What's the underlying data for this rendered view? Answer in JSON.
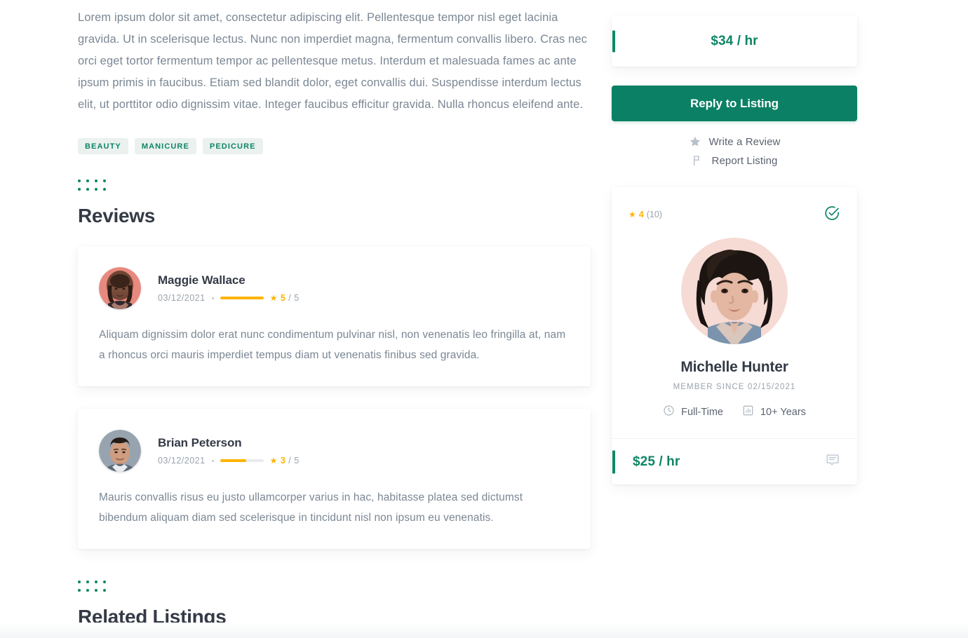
{
  "listing": {
    "description": "Lorem ipsum dolor sit amet, consectetur adipiscing elit. Pellentesque tempor nisl eget lacinia gravida. Ut in scelerisque lectus. Nunc non imperdiet magna, fermentum convallis libero. Cras nec orci eget tortor fermentum tempor ac pellentesque metus. Interdum et malesuada fames ac ante ipsum primis in faucibus. Etiam sed blandit dolor, eget convallis dui. Suspendisse interdum lectus elit, ut porttitor odio dignissim vitae. Integer faucibus efficitur gravida. Nulla rhoncus eleifend ante.",
    "tags": [
      "BEAUTY",
      "MANICURE",
      "PEDICURE"
    ]
  },
  "reviews_section": {
    "title": "Reviews",
    "items": [
      {
        "name": "Maggie Wallace",
        "date": "03/12/2021",
        "rating": 5,
        "rating_max": "5",
        "rating_pct": 100,
        "body": "Aliquam dignissim dolor erat nunc condimentum pulvinar nisl, non venenatis leo fringilla at, nam a rhoncus orci mauris imperdiet tempus diam ut venenatis finibus sed gravida.",
        "avatar_name": "maggie-wallace-avatar"
      },
      {
        "name": "Brian Peterson",
        "date": "03/12/2021",
        "rating": 3,
        "rating_max": "5",
        "rating_pct": 60,
        "body": "Mauris convallis risus eu justo ullamcorper varius in hac, habitasse platea sed dictumst bibendum aliquam diam sed scelerisque in tincidunt nisl non ipsum eu venenatis.",
        "avatar_name": "brian-peterson-avatar"
      }
    ]
  },
  "related_section": {
    "title": "Related Listings"
  },
  "sidebar": {
    "price": "$34 / hr",
    "reply_button": "Reply to Listing",
    "actions": [
      {
        "label": "Write a Review",
        "icon": "star-icon"
      },
      {
        "label": "Report Listing",
        "icon": "flag-icon"
      }
    ],
    "profile": {
      "rating_value": "4",
      "rating_count": "(10)",
      "rating_pct": 80,
      "name": "Michelle Hunter",
      "member_since": "MEMBER SINCE 02/15/2021",
      "facts": [
        {
          "label": "Full-Time",
          "icon": "clock-icon"
        },
        {
          "label": "10+ Years",
          "icon": "bar-chart-icon"
        }
      ],
      "price": "$25 / hr",
      "verified_icon": "check-circle-icon",
      "message_icon": "message-icon"
    }
  },
  "colors": {
    "brand_green": "#0e8566",
    "button_green": "#0b8064",
    "star_yellow": "#ffb400",
    "heading": "#343a46",
    "body_text": "#7b8794",
    "muted": "#9aa3ad",
    "tag_bg": "#eaf1ef"
  }
}
